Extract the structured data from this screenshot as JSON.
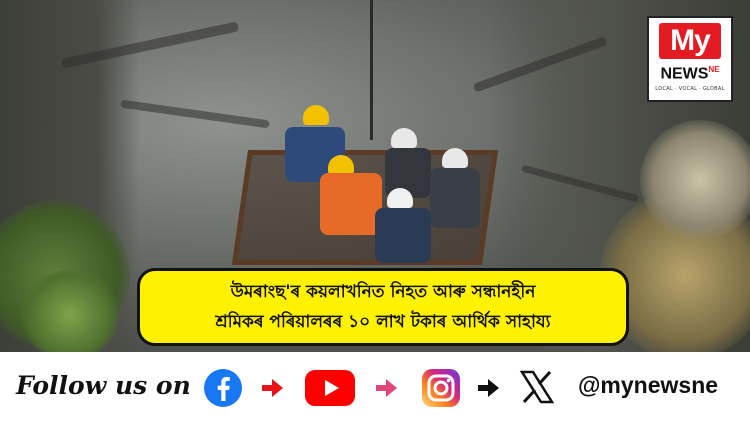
{
  "headline": {
    "line1": "উমৰাংছ'ৰ কয়লাখনিত নিহত আৰু সন্ধানহীন",
    "line2": "শ্ৰমিকৰ পৰিয়ালৰৰ ১০ লাখ টকাৰ আৰ্থিক সাহায্য"
  },
  "logo": {
    "my": "My",
    "news": "NEWS",
    "ne": "NE",
    "tagline": "LOCAL · VOCAL · GLOBAL"
  },
  "follow": {
    "label": "Follow us on",
    "handle": "@mynewsne",
    "icons": [
      "facebook-icon",
      "youtube-icon",
      "instagram-icon",
      "x-icon"
    ]
  },
  "colors": {
    "caption_bg": "#fff200",
    "logo_red": "#e41b23",
    "arrow_red": "#e8141c",
    "arrow_pink": "#e0457b",
    "facebook": "#1877f2",
    "youtube": "#ff0000"
  }
}
